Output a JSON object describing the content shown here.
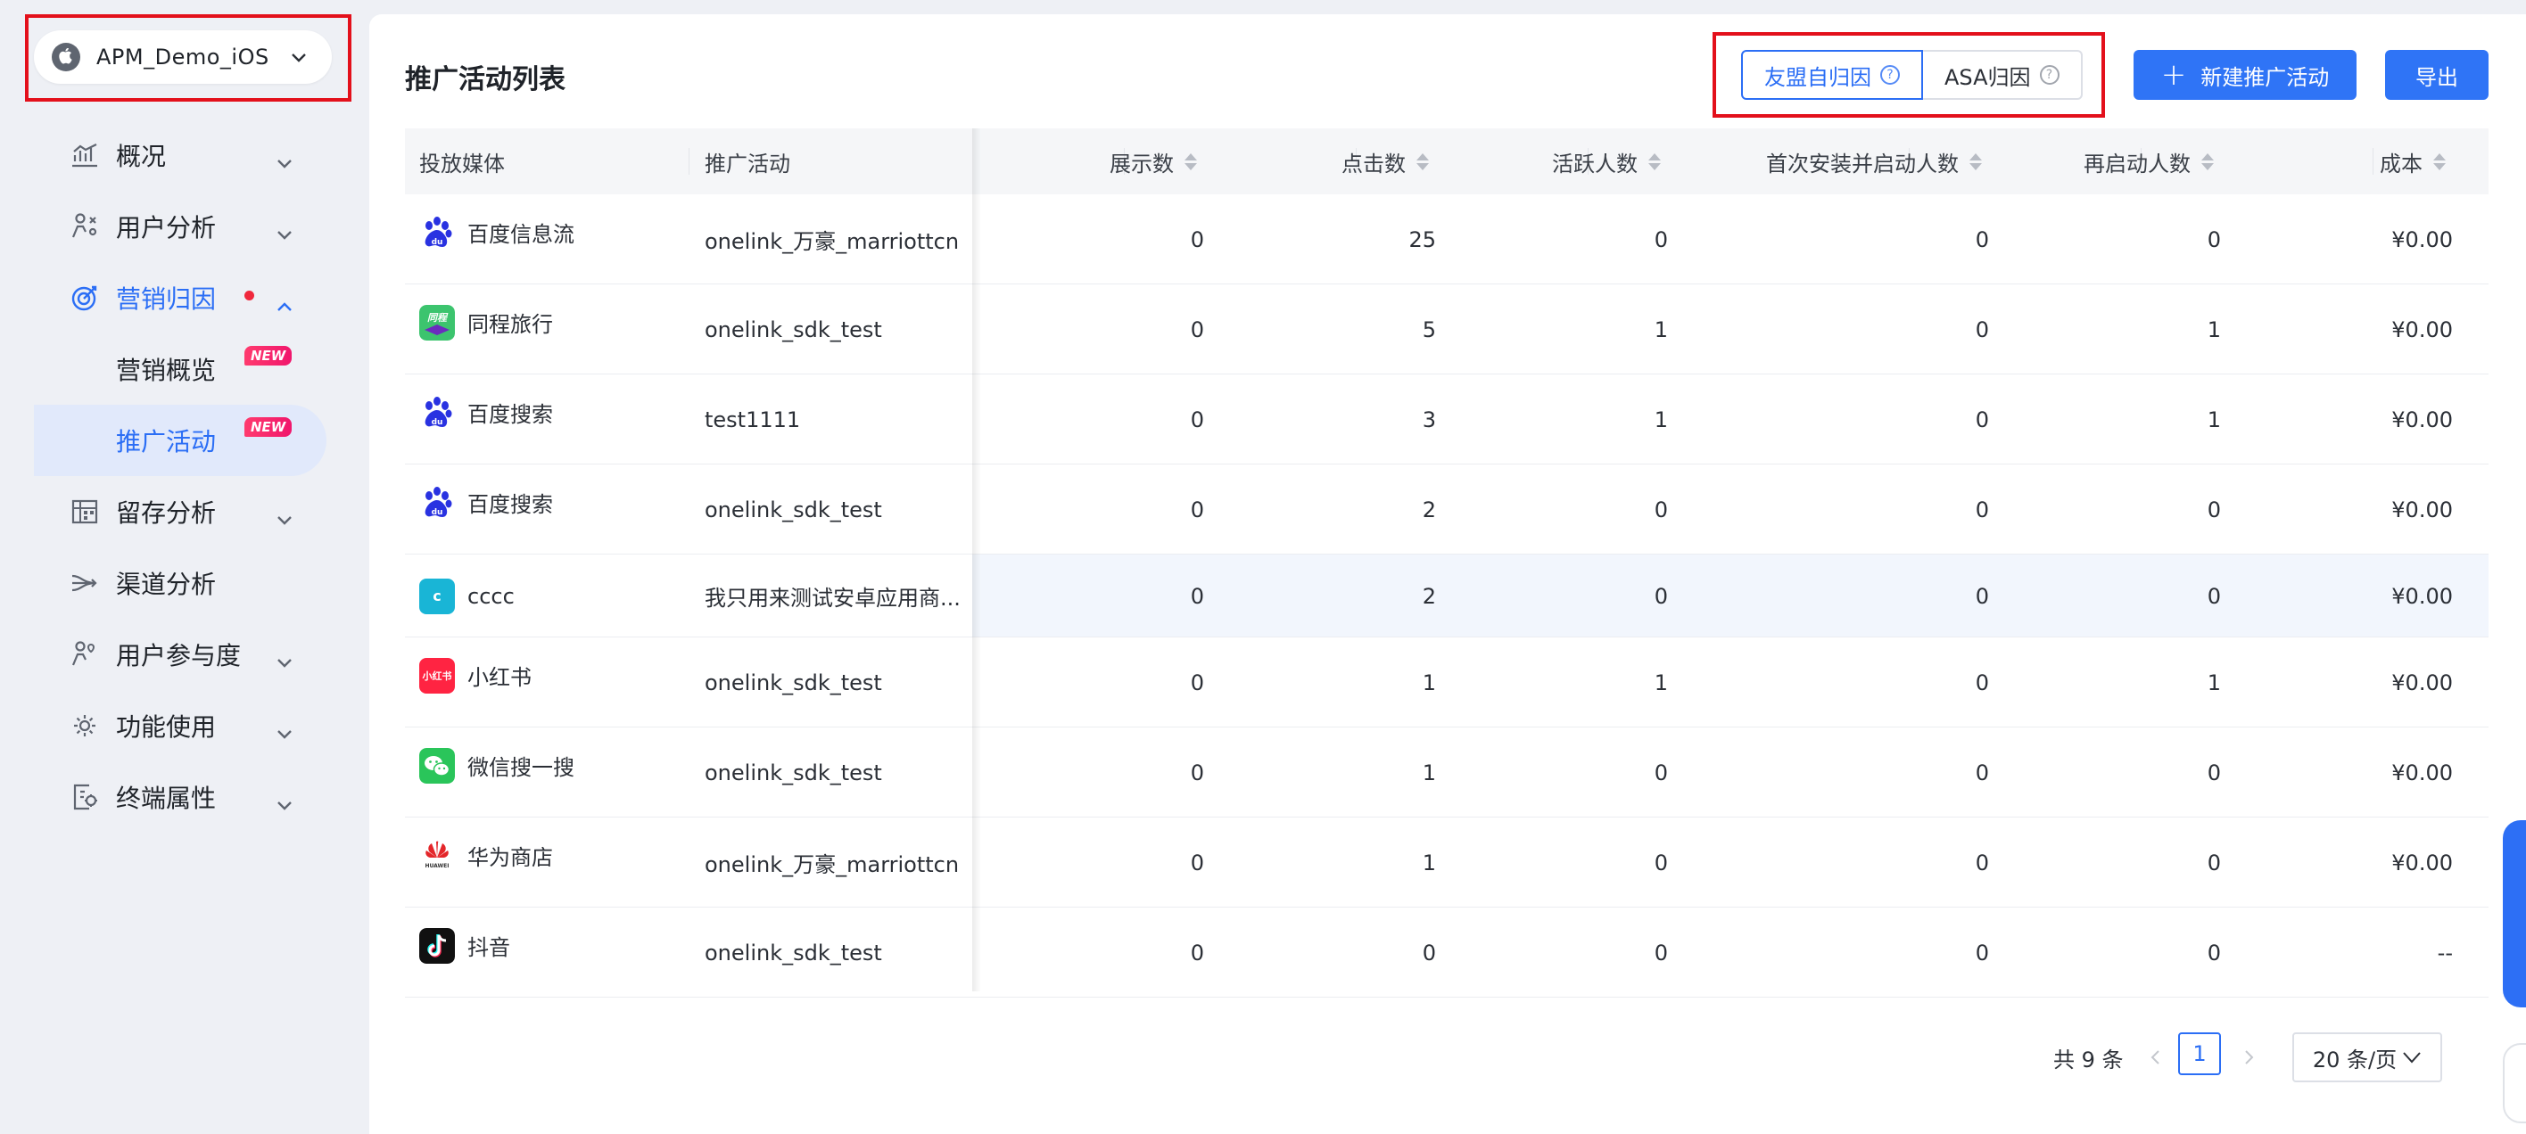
{
  "app": {
    "name": "APM_Demo_iOS"
  },
  "nav": {
    "items": [
      {
        "label": "概况",
        "icon": "trend-chart-icon",
        "chevron": "down"
      },
      {
        "label": "用户分析",
        "icon": "user-analysis-icon",
        "chevron": "down"
      },
      {
        "label": "营销归因",
        "icon": "target-icon",
        "chevron": "up",
        "active": true,
        "dot": true
      },
      {
        "label": "留存分析",
        "icon": "retention-grid-icon",
        "chevron": "down"
      },
      {
        "label": "渠道分析",
        "icon": "channel-flow-icon",
        "chevron": ""
      },
      {
        "label": "用户参与度",
        "icon": "engagement-icon",
        "chevron": "down"
      },
      {
        "label": "功能使用",
        "icon": "feature-gear-icon",
        "chevron": "down"
      },
      {
        "label": "终端属性",
        "icon": "device-attr-icon",
        "chevron": "down"
      }
    ],
    "sub_items": [
      {
        "label": "营销概览",
        "badge": "NEW"
      },
      {
        "label": "推广活动",
        "badge": "NEW",
        "selected": true
      }
    ]
  },
  "page": {
    "title": "推广活动列表",
    "tabs": [
      {
        "label": "友盟自归因",
        "active": true
      },
      {
        "label": "ASA归因",
        "active": false
      }
    ],
    "new_button": "新建推广活动",
    "export_button": "导出"
  },
  "table": {
    "columns": [
      "投放媒体",
      "推广活动",
      "展示数",
      "点击数",
      "活跃人数",
      "首次安装并启动人数",
      "再启动人数",
      "成本"
    ],
    "rows": [
      {
        "media": "百度信息流",
        "icon": "baidu-icon",
        "campaign": "onelink_万豪_marriottcn",
        "impressions": "0",
        "clicks": "25",
        "active": "0",
        "first_install": "0",
        "relaunch": "0",
        "cost": "¥0.00"
      },
      {
        "media": "同程旅行",
        "icon": "tongcheng-icon",
        "campaign": "onelink_sdk_test",
        "impressions": "0",
        "clicks": "5",
        "active": "1",
        "first_install": "0",
        "relaunch": "1",
        "cost": "¥0.00"
      },
      {
        "media": "百度搜索",
        "icon": "baidu-icon",
        "campaign": "test1111",
        "impressions": "0",
        "clicks": "3",
        "active": "1",
        "first_install": "0",
        "relaunch": "1",
        "cost": "¥0.00"
      },
      {
        "media": "百度搜索",
        "icon": "baidu-icon",
        "campaign": "onelink_sdk_test",
        "impressions": "0",
        "clicks": "2",
        "active": "0",
        "first_install": "0",
        "relaunch": "0",
        "cost": "¥0.00"
      },
      {
        "media": "cccc",
        "icon": "c-letter-icon",
        "icon_text": "c",
        "campaign": "我只用来测试安卓应用商...",
        "impressions": "0",
        "clicks": "2",
        "active": "0",
        "first_install": "0",
        "relaunch": "0",
        "cost": "¥0.00"
      },
      {
        "media": "小红书",
        "icon": "xiaohongshu-icon",
        "icon_text": "小红书",
        "campaign": "onelink_sdk_test",
        "impressions": "0",
        "clicks": "1",
        "active": "1",
        "first_install": "0",
        "relaunch": "1",
        "cost": "¥0.00"
      },
      {
        "media": "微信搜一搜",
        "icon": "wechat-icon",
        "campaign": "onelink_sdk_test",
        "impressions": "0",
        "clicks": "1",
        "active": "0",
        "first_install": "0",
        "relaunch": "0",
        "cost": "¥0.00"
      },
      {
        "media": "华为商店",
        "icon": "huawei-icon",
        "campaign": "onelink_万豪_marriottcn",
        "impressions": "0",
        "clicks": "1",
        "active": "0",
        "first_install": "0",
        "relaunch": "0",
        "cost": "¥0.00"
      },
      {
        "media": "抖音",
        "icon": "douyin-icon",
        "campaign": "onelink_sdk_test",
        "impressions": "0",
        "clicks": "0",
        "active": "0",
        "first_install": "0",
        "relaunch": "0",
        "cost": "--"
      }
    ]
  },
  "pagination": {
    "total_label": "共 9 条",
    "current_page": "1",
    "page_size": "20 条/页"
  },
  "colors": {
    "primary": "#2f74f6",
    "highlight_box": "#e3101b",
    "sidebar_bg": "#eef0f5"
  }
}
